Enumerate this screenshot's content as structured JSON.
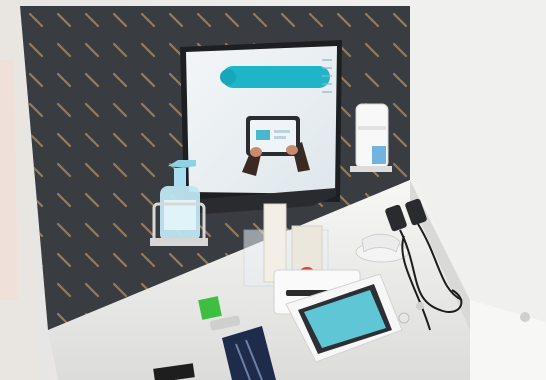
{
  "scene": {
    "description_tag": "health-kiosk-photo",
    "colors": {
      "pegboard": "#3a3d42",
      "peg": "#9a7a52",
      "wall": "#eeedeb",
      "counter": "#f4f4f2",
      "screen_bg": "#e9eef2",
      "screen_accent": "#1fb5c9",
      "tablet_screen": "#5fc6d6",
      "sanitizer_gel": "#9fd6e8",
      "button_red": "#e03a3a",
      "card_green": "#3fbf3f",
      "cable": "#1c1c1c"
    },
    "monitor": {
      "brand_text": "",
      "pill_text": ""
    }
  }
}
